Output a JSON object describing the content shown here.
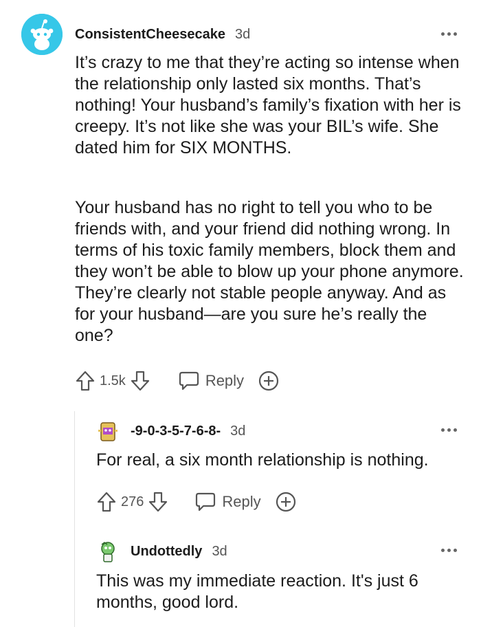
{
  "comments": [
    {
      "username": "ConsistentCheesecake",
      "time": "3d",
      "paragraphs": [
        "It’s crazy to me that they’re acting so intense when the relationship only lasted six months. That’s nothing! Your husband’s family’s fixation with her is creepy. It’s not like she was your BIL’s wife. She dated him for SIX MONTHS.",
        "Your husband has no right to tell you who to be friends with, and your friend did nothing wrong. In terms of his toxic family members, block them and they won’t be able to blow up your phone anymore. They’re clearly not stable people anyway. And as for your husband—are you sure he’s really the one?"
      ],
      "votes": "1.5k",
      "reply_label": "Reply",
      "avatar_color": "#36c7e8"
    },
    {
      "username": "-9-0-3-5-7-6-8-",
      "time": "3d",
      "text": "For real, a six month relationship is nothing.",
      "votes": "276",
      "reply_label": "Reply"
    },
    {
      "username": "Undottedly",
      "time": "3d",
      "text": "This was my immediate reaction. It's just 6 months, good lord."
    }
  ],
  "icons": {
    "upvote": "upvote-arrow-icon",
    "downvote": "downvote-arrow-icon",
    "reply": "speech-bubble-icon",
    "award": "plus-circle-icon",
    "more": "ellipsis-icon"
  },
  "colors": {
    "text": "#1c1c1c",
    "meta": "#555555",
    "avatar_bg": "#36c7e8"
  }
}
